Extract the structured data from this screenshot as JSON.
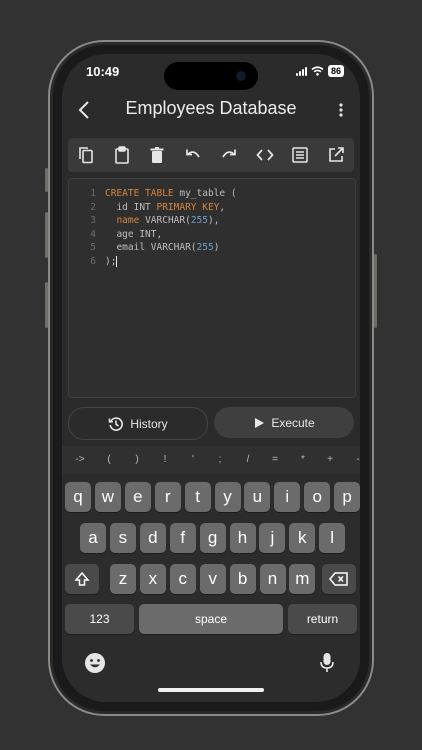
{
  "status_bar": {
    "time": "10:49",
    "battery": "86"
  },
  "nav": {
    "title": "Employees Database"
  },
  "toolbar": {
    "tools": [
      "copy-icon",
      "clipboard-icon",
      "trash-icon",
      "undo-icon",
      "redo-icon",
      "code-icon",
      "list-icon",
      "open-external-icon"
    ]
  },
  "editor": {
    "lines": [
      {
        "number": "1",
        "tokens": [
          {
            "text": "CREATE TABLE",
            "type": "kw"
          },
          {
            "text": " my_table (",
            "type": "txt"
          }
        ]
      },
      {
        "number": "2",
        "tokens": [
          {
            "text": "  id INT ",
            "type": "txt"
          },
          {
            "text": "PRIMARY KEY",
            "type": "kw"
          },
          {
            "text": ",",
            "type": "txt"
          }
        ]
      },
      {
        "number": "3",
        "tokens": [
          {
            "text": "  ",
            "type": "txt"
          },
          {
            "text": "name",
            "type": "kw"
          },
          {
            "text": " VARCHAR(",
            "type": "txt"
          },
          {
            "text": "255",
            "type": "num"
          },
          {
            "text": "),",
            "type": "txt"
          }
        ]
      },
      {
        "number": "4",
        "tokens": [
          {
            "text": "  age INT,",
            "type": "txt"
          }
        ]
      },
      {
        "number": "5",
        "tokens": [
          {
            "text": "  email VARCHAR(",
            "type": "txt"
          },
          {
            "text": "255",
            "type": "num"
          },
          {
            "text": ")",
            "type": "txt"
          }
        ]
      },
      {
        "number": "6",
        "tokens": [
          {
            "text": ");",
            "type": "txt"
          }
        ]
      }
    ]
  },
  "actions": {
    "history_label": "History",
    "execute_label": "Execute"
  },
  "keyboard": {
    "symbols": [
      "->",
      "(",
      ")",
      "!",
      "'",
      ";",
      "/",
      "=",
      "*",
      "+",
      "-"
    ],
    "row1": [
      "q",
      "w",
      "e",
      "r",
      "t",
      "y",
      "u",
      "i",
      "o",
      "p"
    ],
    "row2": [
      "a",
      "s",
      "d",
      "f",
      "g",
      "h",
      "j",
      "k",
      "l"
    ],
    "row3": [
      "z",
      "x",
      "c",
      "v",
      "b",
      "n",
      "m"
    ],
    "numbers_label": "123",
    "space_label": "space",
    "return_label": "return"
  }
}
